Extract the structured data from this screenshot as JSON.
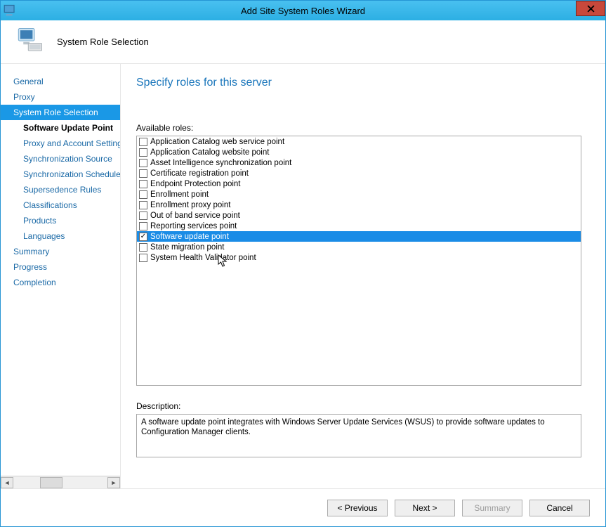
{
  "window": {
    "title": "Add Site System Roles Wizard"
  },
  "header": {
    "heading": "System Role Selection"
  },
  "sidebar": {
    "items": [
      {
        "label": "General",
        "kind": "top"
      },
      {
        "label": "Proxy",
        "kind": "top"
      },
      {
        "label": "System Role Selection",
        "kind": "top",
        "active": true
      },
      {
        "label": "Software Update Point",
        "kind": "sub",
        "bold": true
      },
      {
        "label": "Proxy and Account Settings",
        "kind": "sub"
      },
      {
        "label": "Synchronization Source",
        "kind": "sub"
      },
      {
        "label": "Synchronization Schedule",
        "kind": "sub"
      },
      {
        "label": "Supersedence Rules",
        "kind": "sub"
      },
      {
        "label": "Classifications",
        "kind": "sub"
      },
      {
        "label": "Products",
        "kind": "sub"
      },
      {
        "label": "Languages",
        "kind": "sub"
      },
      {
        "label": "Summary",
        "kind": "top"
      },
      {
        "label": "Progress",
        "kind": "top"
      },
      {
        "label": "Completion",
        "kind": "top"
      }
    ]
  },
  "main": {
    "title": "Specify roles for this server",
    "available_label": "Available roles:",
    "roles": [
      {
        "label": "Application Catalog web service point",
        "checked": false,
        "selected": false
      },
      {
        "label": "Application Catalog website point",
        "checked": false,
        "selected": false
      },
      {
        "label": "Asset Intelligence synchronization point",
        "checked": false,
        "selected": false
      },
      {
        "label": "Certificate registration point",
        "checked": false,
        "selected": false
      },
      {
        "label": "Endpoint Protection point",
        "checked": false,
        "selected": false
      },
      {
        "label": "Enrollment point",
        "checked": false,
        "selected": false
      },
      {
        "label": "Enrollment proxy point",
        "checked": false,
        "selected": false
      },
      {
        "label": "Out of band service point",
        "checked": false,
        "selected": false
      },
      {
        "label": "Reporting services point",
        "checked": false,
        "selected": false
      },
      {
        "label": "Software update point",
        "checked": true,
        "selected": true
      },
      {
        "label": "State migration point",
        "checked": false,
        "selected": false
      },
      {
        "label": "System Health Validator point",
        "checked": false,
        "selected": false
      }
    ],
    "description_label": "Description:",
    "description_text": "A software update point integrates with Windows Server Update Services (WSUS) to provide software updates to Configuration Manager clients."
  },
  "footer": {
    "previous": "< Previous",
    "next": "Next >",
    "summary": "Summary",
    "cancel": "Cancel"
  }
}
